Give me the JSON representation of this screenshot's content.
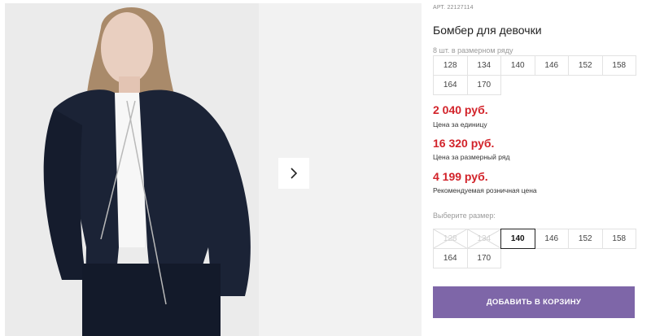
{
  "product": {
    "article_label": "АРТ.",
    "article": "22127114",
    "title": "Бомбер для девочки",
    "pack_note": "8 шт. в размерном ряду",
    "pack_sizes": [
      "128",
      "134",
      "140",
      "146",
      "152",
      "158",
      "164",
      "170"
    ]
  },
  "prices": [
    {
      "value": "2 040 руб.",
      "note": "Цена за единицу"
    },
    {
      "value": "16 320 руб.",
      "note": "Цена за размерный ряд"
    },
    {
      "value": "4 199 руб.",
      "note": "Рекомендуемая розничная цена"
    }
  ],
  "size_select": {
    "label": "Выберите размер:",
    "sizes": [
      {
        "label": "128",
        "state": "disabled"
      },
      {
        "label": "134",
        "state": "disabled"
      },
      {
        "label": "140",
        "state": "selected"
      },
      {
        "label": "146",
        "state": "available"
      },
      {
        "label": "152",
        "state": "available"
      },
      {
        "label": "158",
        "state": "available"
      },
      {
        "label": "164",
        "state": "available"
      },
      {
        "label": "170",
        "state": "available"
      }
    ]
  },
  "cart_button": "ДОБАВИТЬ В КОРЗИНУ",
  "gallery": {
    "next_icon": "chevron-right-icon"
  },
  "colors": {
    "price": "#d2232a",
    "button": "#7e66a8",
    "jacket": "#1b2336"
  }
}
